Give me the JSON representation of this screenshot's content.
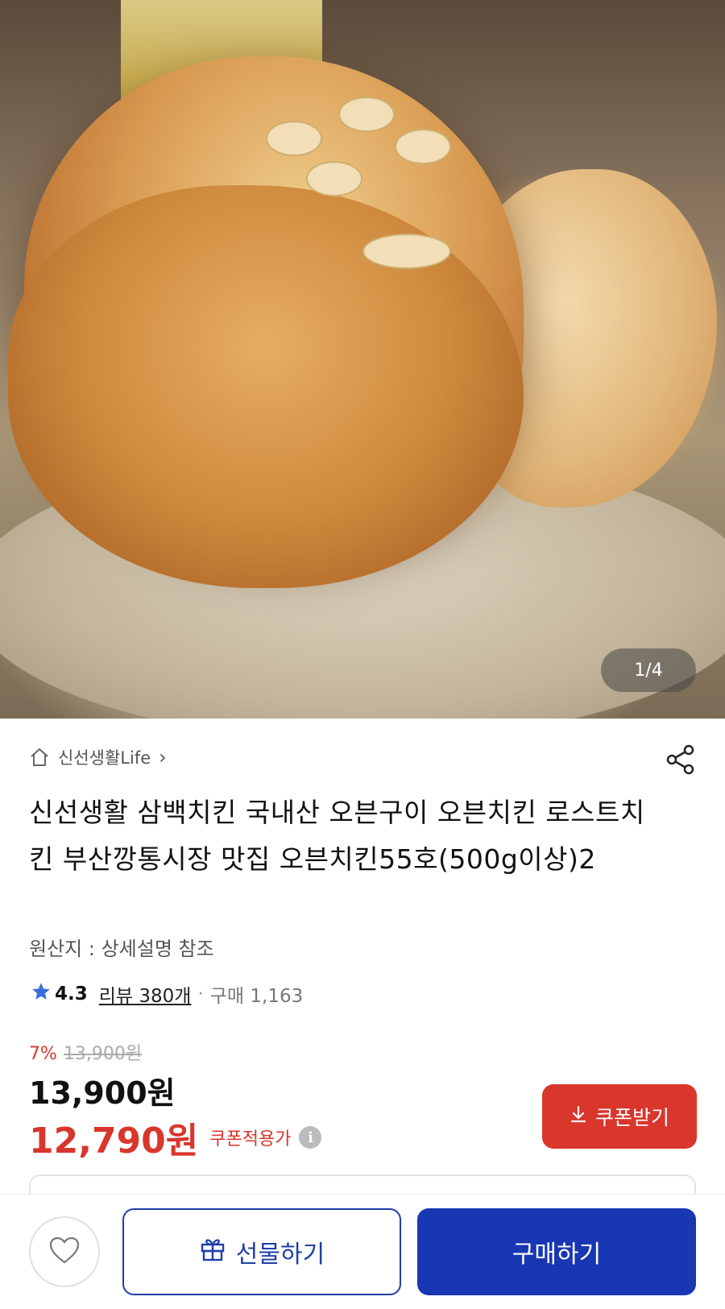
{
  "product_image": {
    "alt_icon": "roast-chicken-photo",
    "counter": "1/4"
  },
  "store": {
    "name": "신선생활Life",
    "chevron": "›"
  },
  "product": {
    "title": "신선생활 삼백치킨 국내산 오븐구이 오븐치킨 로스트치킨 부산깡통시장 맛집   오븐치킨55호(500g이상)2",
    "origin": "원산지 : 상세설명 참조"
  },
  "rating": {
    "score": "4.3",
    "review": "리뷰 380개",
    "dot": "·",
    "purchases": "구매 1,163"
  },
  "pricing": {
    "discount_rate": "7%",
    "original_price": "13,900원",
    "price": "13,900원",
    "coupon_price": "12,790원",
    "coupon_label": "쿠폰적용가",
    "info": "i"
  },
  "coupon_button": {
    "label": "쿠폰받기"
  },
  "bottom_bar": {
    "gift_label": "선물하기",
    "buy_label": "구매하기"
  },
  "colors": {
    "accent_red": "#d9362c",
    "primary_blue": "#1936b3",
    "star_blue": "#3b6fe0"
  }
}
